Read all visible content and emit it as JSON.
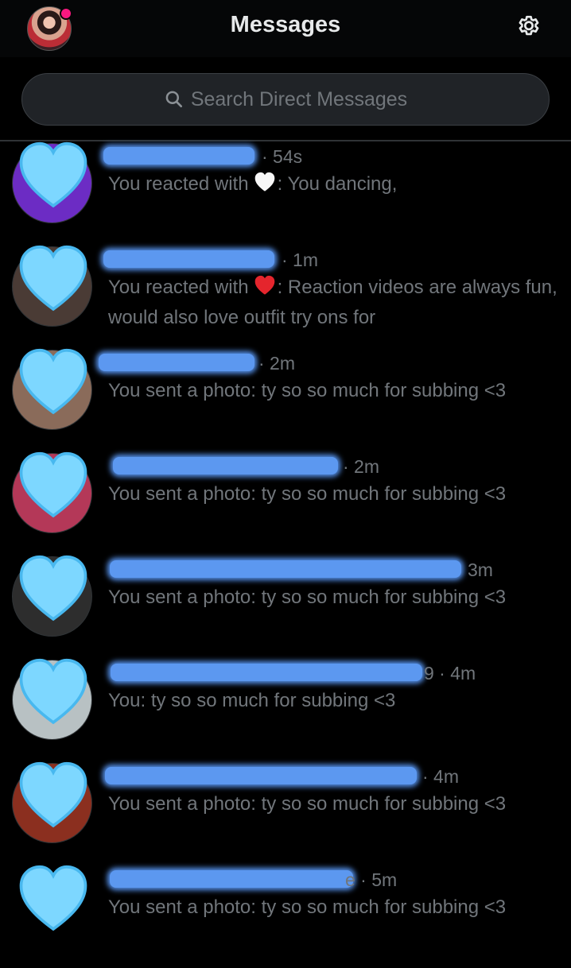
{
  "header": {
    "title": "Messages",
    "profile_icon": "profile-avatar",
    "settings_icon": "gear-icon"
  },
  "search": {
    "placeholder": "Search Direct Messages",
    "icon": "search-icon"
  },
  "conversations": [
    {
      "time": "· 54s",
      "prefix": "You reacted with",
      "reaction": "white-heart",
      "suffix": ": You dancing,"
    },
    {
      "time": "· 1m",
      "prefix": "You reacted with",
      "reaction": "red-heart",
      "suffix": ": Reaction videos are always fun, would also love outfit try ons for"
    },
    {
      "time": "· 2m",
      "preview": "You sent a photo: ty so so much for subbing <3"
    },
    {
      "time": "· 2m",
      "preview": "You sent a photo: ty so so much for subbing <3"
    },
    {
      "time": "3m",
      "preview": "You sent a photo: ty so so much for subbing <3"
    },
    {
      "time": "9 · 4m",
      "preview": "You: ty so so much for subbing <3"
    },
    {
      "time": "· 4m",
      "preview": "You sent a photo: ty so so much for subbing <3"
    },
    {
      "time": "e · 5m",
      "preview": "You sent a photo: ty so so much for subbing <3"
    }
  ],
  "colors": {
    "background": "#000000",
    "text": "#e7e9ea",
    "muted": "#71767b",
    "redaction": "#5c98f0",
    "heart": "#7dd7ff"
  }
}
